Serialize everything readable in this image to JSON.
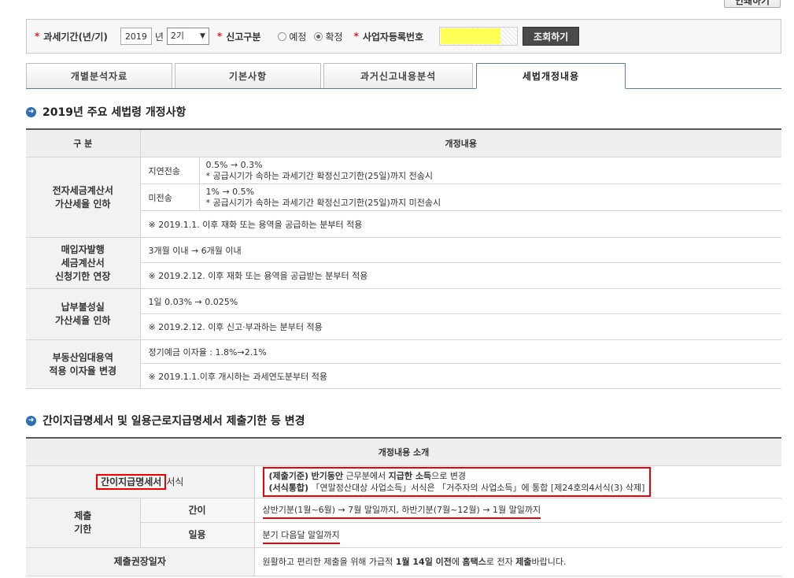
{
  "header": {
    "print_label": "인쇄하기"
  },
  "search": {
    "period_label": "과세기간(년/기)",
    "year_value": "2019",
    "year_unit": "년",
    "term_value": "2기",
    "report_label": "신고구분",
    "radio_preliminary": "예정",
    "radio_final": "확정",
    "selected_radio": "확정",
    "reg_label": "사업자등록번호",
    "search_btn": "조회하기"
  },
  "tabs": [
    {
      "label": "개별분석자료"
    },
    {
      "label": "기본사항"
    },
    {
      "label": "과거신고내용분석"
    },
    {
      "label": "세법개정내용"
    }
  ],
  "active_tab": "세법개정내용",
  "section1": {
    "title": "2019년 주요 세법령 개정사항",
    "col1": "구 분",
    "col2": "개정내용",
    "rows": {
      "e_invoice": {
        "cat": "전자세금계산서\n가산세율 인하",
        "late_sub": "지연전송",
        "late_l1": "0.5% → 0.3%",
        "late_l2": "* 공급시기가 속하는 과세기간 확정신고기한(25일)까지 전송시",
        "not_sub": "미전송",
        "not_l1": "1% → 0.5%",
        "not_l2": "* 공급시기가 속하는 과세기간 확정신고기한(25일)까지 미전송시",
        "note": "※ 2019.1.1. 이후 재화 또는 용역을 공급하는 분부터 적용"
      },
      "buyer_issue": {
        "cat": "매입자발행\n세금계산서\n신청기한 연장",
        "line": "3개월 이내 → 6개월 이내",
        "note": "※ 2019.2.12. 이후 재화 또는 용역을 공급받는 분부터 적용"
      },
      "late_payment": {
        "cat": "납부불성실\n가산세율 인하",
        "line": "1일 0.03% → 0.025%",
        "note": "※ 2019.2.12. 이후 신고·부과하는 분부터 적용"
      },
      "real_estate": {
        "cat": "부동산임대용역\n적용 이자율 변경",
        "line": "정기예금 이자율 : 1.8%→2.1%",
        "note": "※ 2019.1.1.이후 개시하는 과세연도분부터 적용"
      }
    }
  },
  "section2": {
    "title": "간이지급명세서 및 일용근로지급명세서 제출기한 등 변경",
    "header": "개정내용 소개",
    "form_cat_boxed": "간이지급명세서",
    "form_cat_rest": "서식",
    "form_l1_a": "(제출기준)",
    "form_l1_b": "반기동안",
    "form_l1_c": "근무분에서",
    "form_l1_d": "지급한 소득",
    "form_l1_e": "으로 변경",
    "form_l2_a": "(서식통합)",
    "form_l2_b": "「연말정산대상 사업소득」서식은 「거주자의 사업소득」에 통합 [제24호의4서식(3) 삭제]",
    "deadline_cat": "제출\n기한",
    "simple_sub": "간이",
    "simple_line": "상반기분(1월~6월) → 7월 말일까지, 하반기분(7월~12월) → 1월 말일까지",
    "daily_sub": "일용",
    "daily_line": "분기 다음달 말일까지",
    "rec_cat": "제출권장일자",
    "rec_a": "원활하고 편리한 제출을 위해 가급적",
    "rec_b": "1월 14일 이전",
    "rec_c": "에",
    "rec_d": "홈택스",
    "rec_e": "로 전자",
    "rec_f": "제출",
    "rec_g": "바랍니다."
  },
  "colors": {
    "accent_blue": "#2f6fb5",
    "required_red": "#d6202a",
    "highlight_red": "#ee0000",
    "masked_yellow": "#ffff55"
  }
}
